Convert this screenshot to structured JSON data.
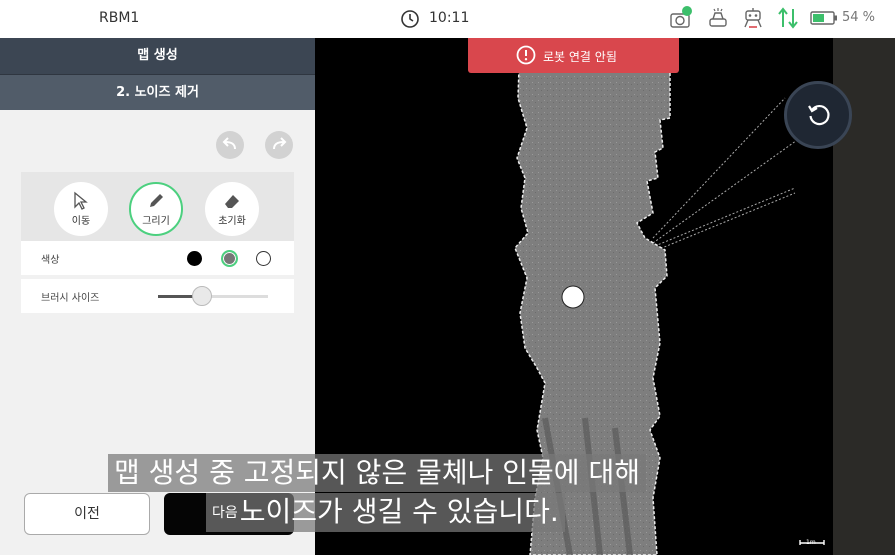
{
  "status_bar": {
    "device_name": "RBM1",
    "time": "10:11",
    "battery_percent": "54 %",
    "icons": [
      "camera-icon",
      "vacuum-icon",
      "robot-icon",
      "data-transfer-icon",
      "battery-icon"
    ],
    "colors": {
      "active_icon": "#3cbf6b",
      "battery": "#3cbf6b"
    }
  },
  "panel": {
    "title": "맵 생성",
    "step_title": "2. 노이즈 제거",
    "tools": [
      {
        "label": "이동",
        "icon": "cursor-icon",
        "selected": false
      },
      {
        "label": "그리기",
        "icon": "pencil-icon",
        "selected": true
      },
      {
        "label": "초기화",
        "icon": "eraser-icon",
        "selected": false
      }
    ],
    "color_label": "색상",
    "colors": [
      {
        "name": "black",
        "hex": "#000000",
        "selected": false
      },
      {
        "name": "gray",
        "hex": "#777777",
        "selected": true
      },
      {
        "name": "white",
        "hex": "#ffffff",
        "selected": false
      }
    ],
    "brush_label": "브러시 사이즈",
    "brush_level": 0.4,
    "prev_label": "이전",
    "next_label": "다음"
  },
  "map": {
    "alert_text": "로봇 연결 안됨",
    "scale_label": "1m",
    "alert_color": "#d9474d",
    "selection_color": "#4cd07f"
  },
  "subtitles": {
    "line1": "맵 생성 중 고정되지 않은 물체나 인물에 대해",
    "line2": "노이즈가 생길 수 있습니다."
  }
}
